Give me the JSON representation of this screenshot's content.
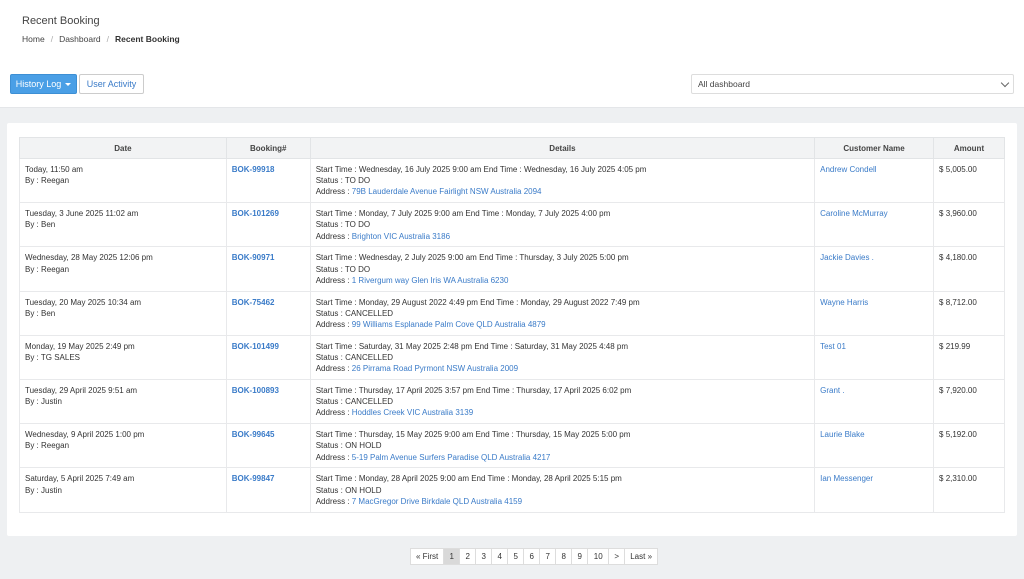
{
  "page": {
    "title": "Recent Booking",
    "breadcrumb": [
      "Home",
      "Dashboard",
      "Recent Booking"
    ]
  },
  "toolbar": {
    "history_log": "History Log",
    "user_activity": "User Activity",
    "dashboard_select": "All dashboard"
  },
  "table": {
    "headers": [
      "Date",
      "Booking#",
      "Details",
      "Customer Name",
      "Amount"
    ],
    "rows": [
      {
        "date": "Today, 11:50 am",
        "by": "By : Reegan",
        "booking": "BOK-99918",
        "start": "Start Time : Wednesday, 16 July 2025 9:00 am End Time : Wednesday, 16 July 2025 4:05 pm",
        "status": "Status : TO DO",
        "address_label": "Address :",
        "address": "79B Lauderdale Avenue Fairlight NSW Australia 2094",
        "customer": "Andrew Condell",
        "amount": "$ 5,005.00"
      },
      {
        "date": "Tuesday, 3 June 2025 11:02 am",
        "by": "By : Ben",
        "booking": "BOK-101269",
        "start": "Start Time : Monday, 7 July 2025 9:00 am End Time : Monday, 7 July 2025 4:00 pm",
        "status": "Status : TO DO",
        "address_label": "Address :",
        "address": "Brighton VIC Australia 3186",
        "customer": "Caroline McMurray",
        "amount": "$ 3,960.00"
      },
      {
        "date": "Wednesday, 28 May 2025 12:06 pm",
        "by": "By : Reegan",
        "booking": "BOK-90971",
        "start": "Start Time : Wednesday, 2 July 2025 9:00 am End Time : Thursday, 3 July 2025 5:00 pm",
        "status": "Status : TO DO",
        "address_label": "Address :",
        "address": "1 Rivergum way Glen Iris WA Australia 6230",
        "customer": "Jackie Davies .",
        "amount": "$ 4,180.00"
      },
      {
        "date": "Tuesday, 20 May 2025 10:34 am",
        "by": "By : Ben",
        "booking": "BOK-75462",
        "start": "Start Time : Monday, 29 August 2022 4:49 pm End Time : Monday, 29 August 2022 7:49 pm",
        "status": "Status : CANCELLED",
        "address_label": "Address :",
        "address": "99 Williams Esplanade Palm Cove QLD Australia 4879",
        "customer": "Wayne Harris",
        "amount": "$ 8,712.00"
      },
      {
        "date": "Monday, 19 May 2025 2:49 pm",
        "by": "By : TG SALES",
        "booking": "BOK-101499",
        "start": "Start Time : Saturday, 31 May 2025 2:48 pm End Time : Saturday, 31 May 2025 4:48 pm",
        "status": "Status : CANCELLED",
        "address_label": "Address :",
        "address": "26 Pirrama Road Pyrmont NSW Australia 2009",
        "customer": "Test 01",
        "amount": "$ 219.99"
      },
      {
        "date": "Tuesday, 29 April 2025 9:51 am",
        "by": "By : Justin",
        "booking": "BOK-100893",
        "start": "Start Time : Thursday, 17 April 2025 3:57 pm End Time : Thursday, 17 April 2025 6:02 pm",
        "status": "Status : CANCELLED",
        "address_label": "Address :",
        "address": "Hoddles Creek VIC Australia 3139",
        "customer": "Grant .",
        "amount": "$ 7,920.00"
      },
      {
        "date": "Wednesday, 9 April 2025 1:00 pm",
        "by": "By : Reegan",
        "booking": "BOK-99645",
        "start": "Start Time : Thursday, 15 May 2025 9:00 am End Time : Thursday, 15 May 2025 5:00 pm",
        "status": "Status : ON HOLD",
        "address_label": "Address :",
        "address": "5-19 Palm Avenue Surfers Paradise QLD Australia 4217",
        "customer": "Laurie Blake",
        "amount": "$ 5,192.00"
      },
      {
        "date": "Saturday, 5 April 2025 7:49 am",
        "by": "By : Justin",
        "booking": "BOK-99847",
        "start": "Start Time : Monday, 28 April 2025 9:00 am End Time : Monday, 28 April 2025 5:15 pm",
        "status": "Status : ON HOLD",
        "address_label": "Address :",
        "address": "7 MacGregor Drive Birkdale QLD Australia 4159",
        "customer": "Ian Messenger",
        "amount": "$ 2,310.00"
      }
    ]
  },
  "pagination": {
    "first": "« First",
    "pages": [
      "1",
      "2",
      "3",
      "4",
      "5",
      "6",
      "7",
      "8",
      "9",
      "10"
    ],
    "active": "1",
    "next": ">",
    "last": "Last »"
  },
  "colors": {
    "primary": "#4a9fe6",
    "link": "#3a7bc8"
  }
}
